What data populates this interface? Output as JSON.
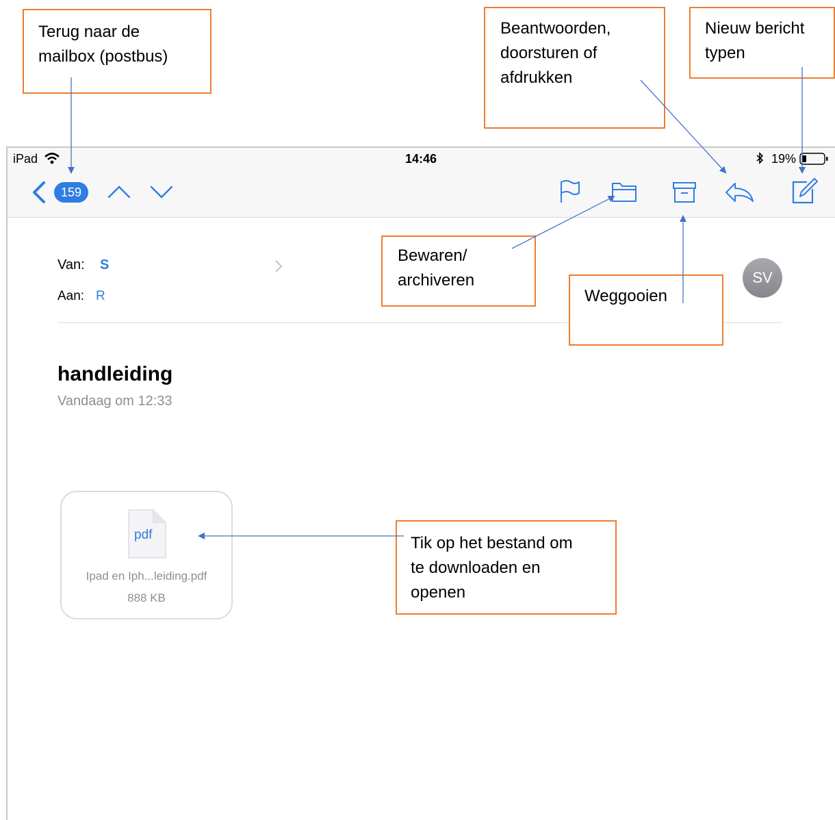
{
  "colors": {
    "accent": "#2f7de1",
    "callout_border": "#ed7d31",
    "arrow": "#4472c4",
    "navbar_bg": "#f7f7f8",
    "secondary_text": "#8e8e93"
  },
  "status_bar": {
    "device": "iPad",
    "time": "14:46",
    "battery": "19%",
    "icons": [
      "wifi-icon",
      "bluetooth-icon",
      "battery-icon"
    ]
  },
  "navbar": {
    "back_count": "159",
    "icons": [
      "back-chevron-icon",
      "chevron-up-icon",
      "chevron-down-icon",
      "flag-icon",
      "folder-icon",
      "archive-box-icon",
      "reply-icon",
      "compose-icon"
    ]
  },
  "message": {
    "from_label": "Van:",
    "from_value": "S",
    "to_label": "Aan:",
    "to_value": "R",
    "avatar_initials": "SV",
    "subject": "handleiding",
    "date": "Vandaag om 12:33"
  },
  "attachment": {
    "type_label": "pdf",
    "name": "Ipad en Iph...leiding.pdf",
    "size": "888 KB"
  },
  "callouts": {
    "back": "Terug naar de\nmailbox (postbus)",
    "reply": "Beantwoorden,\ndoorsturen of\nafdrukken",
    "compose": "Nieuw bericht\ntypen",
    "archive": "Bewaren/\narchiveren",
    "trash": "Weggooien",
    "attachment": "Tik op het bestand om\nte downloaden en\nopenen"
  }
}
